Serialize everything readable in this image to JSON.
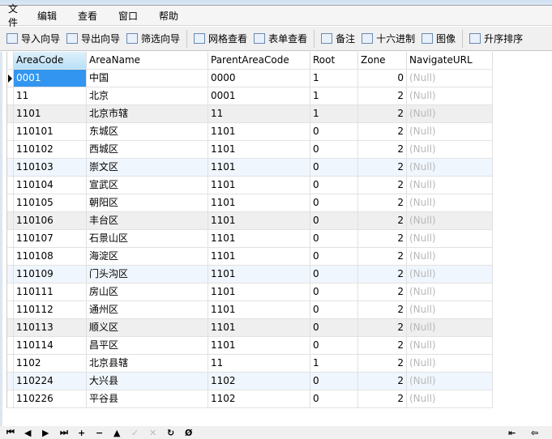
{
  "menu": [
    "文件",
    "编辑",
    "查看",
    "窗口",
    "帮助"
  ],
  "toolbar": [
    {
      "label": "导入向导",
      "icon": "import-wizard-icon"
    },
    {
      "label": "导出向导",
      "icon": "export-wizard-icon"
    },
    {
      "label": "筛选向导",
      "icon": "filter-icon"
    },
    {
      "label": "网格查看",
      "icon": "grid-view-icon"
    },
    {
      "label": "表单查看",
      "icon": "form-view-icon"
    },
    {
      "label": "备注",
      "icon": "note-icon"
    },
    {
      "label": "十六进制",
      "icon": "hex-icon"
    },
    {
      "label": "图像",
      "icon": "image-icon"
    },
    {
      "label": "升序排序",
      "icon": "sort-ascending-icon"
    }
  ],
  "grid": {
    "columns": [
      "AreaCode",
      "AreaName",
      "ParentAreaCode",
      "Root",
      "Zone",
      "NavigateURL"
    ],
    "rows": [
      [
        "0001",
        "中国",
        "0000",
        "1",
        "0",
        "(Null)"
      ],
      [
        "11",
        "北京",
        "0001",
        "1",
        "2",
        "(Null)"
      ],
      [
        "1101",
        "北京市辖",
        "11",
        "1",
        "2",
        "(Null)"
      ],
      [
        "110101",
        "东城区",
        "1101",
        "0",
        "2",
        "(Null)"
      ],
      [
        "110102",
        "西城区",
        "1101",
        "0",
        "2",
        "(Null)"
      ],
      [
        "110103",
        "崇文区",
        "1101",
        "0",
        "2",
        "(Null)"
      ],
      [
        "110104",
        "宣武区",
        "1101",
        "0",
        "2",
        "(Null)"
      ],
      [
        "110105",
        "朝阳区",
        "1101",
        "0",
        "2",
        "(Null)"
      ],
      [
        "110106",
        "丰台区",
        "1101",
        "0",
        "2",
        "(Null)"
      ],
      [
        "110107",
        "石景山区",
        "1101",
        "0",
        "2",
        "(Null)"
      ],
      [
        "110108",
        "海淀区",
        "1101",
        "0",
        "2",
        "(Null)"
      ],
      [
        "110109",
        "门头沟区",
        "1101",
        "0",
        "2",
        "(Null)"
      ],
      [
        "110111",
        "房山区",
        "1101",
        "0",
        "2",
        "(Null)"
      ],
      [
        "110112",
        "通州区",
        "1101",
        "0",
        "2",
        "(Null)"
      ],
      [
        "110113",
        "顺义区",
        "1101",
        "0",
        "2",
        "(Null)"
      ],
      [
        "110114",
        "昌平区",
        "1101",
        "0",
        "2",
        "(Null)"
      ],
      [
        "1102",
        "北京县辖",
        "11",
        "1",
        "2",
        "(Null)"
      ],
      [
        "110224",
        "大兴县",
        "1102",
        "0",
        "2",
        "(Null)"
      ],
      [
        "110226",
        "平谷县",
        "1102",
        "0",
        "2",
        "(Null)"
      ]
    ]
  },
  "navigator": {
    "buttons": [
      {
        "glyph": "⏮",
        "name": "first-record"
      },
      {
        "glyph": "◀",
        "name": "prior-record"
      },
      {
        "glyph": "▶",
        "name": "next-record"
      },
      {
        "glyph": "⏭",
        "name": "last-record"
      },
      {
        "glyph": "+",
        "name": "insert-record"
      },
      {
        "glyph": "−",
        "name": "delete-record"
      },
      {
        "glyph": "▲",
        "name": "edit-record"
      },
      {
        "glyph": "✓",
        "name": "post-edit",
        "disabled": true
      },
      {
        "glyph": "✕",
        "name": "cancel-edit",
        "disabled": true
      },
      {
        "glyph": "↻",
        "name": "refresh"
      },
      {
        "glyph": "Ø",
        "name": "set-null"
      }
    ],
    "right": [
      {
        "glyph": "⇤",
        "name": "scroll-first"
      },
      {
        "glyph": "⇦",
        "name": "scroll-prev"
      }
    ]
  }
}
